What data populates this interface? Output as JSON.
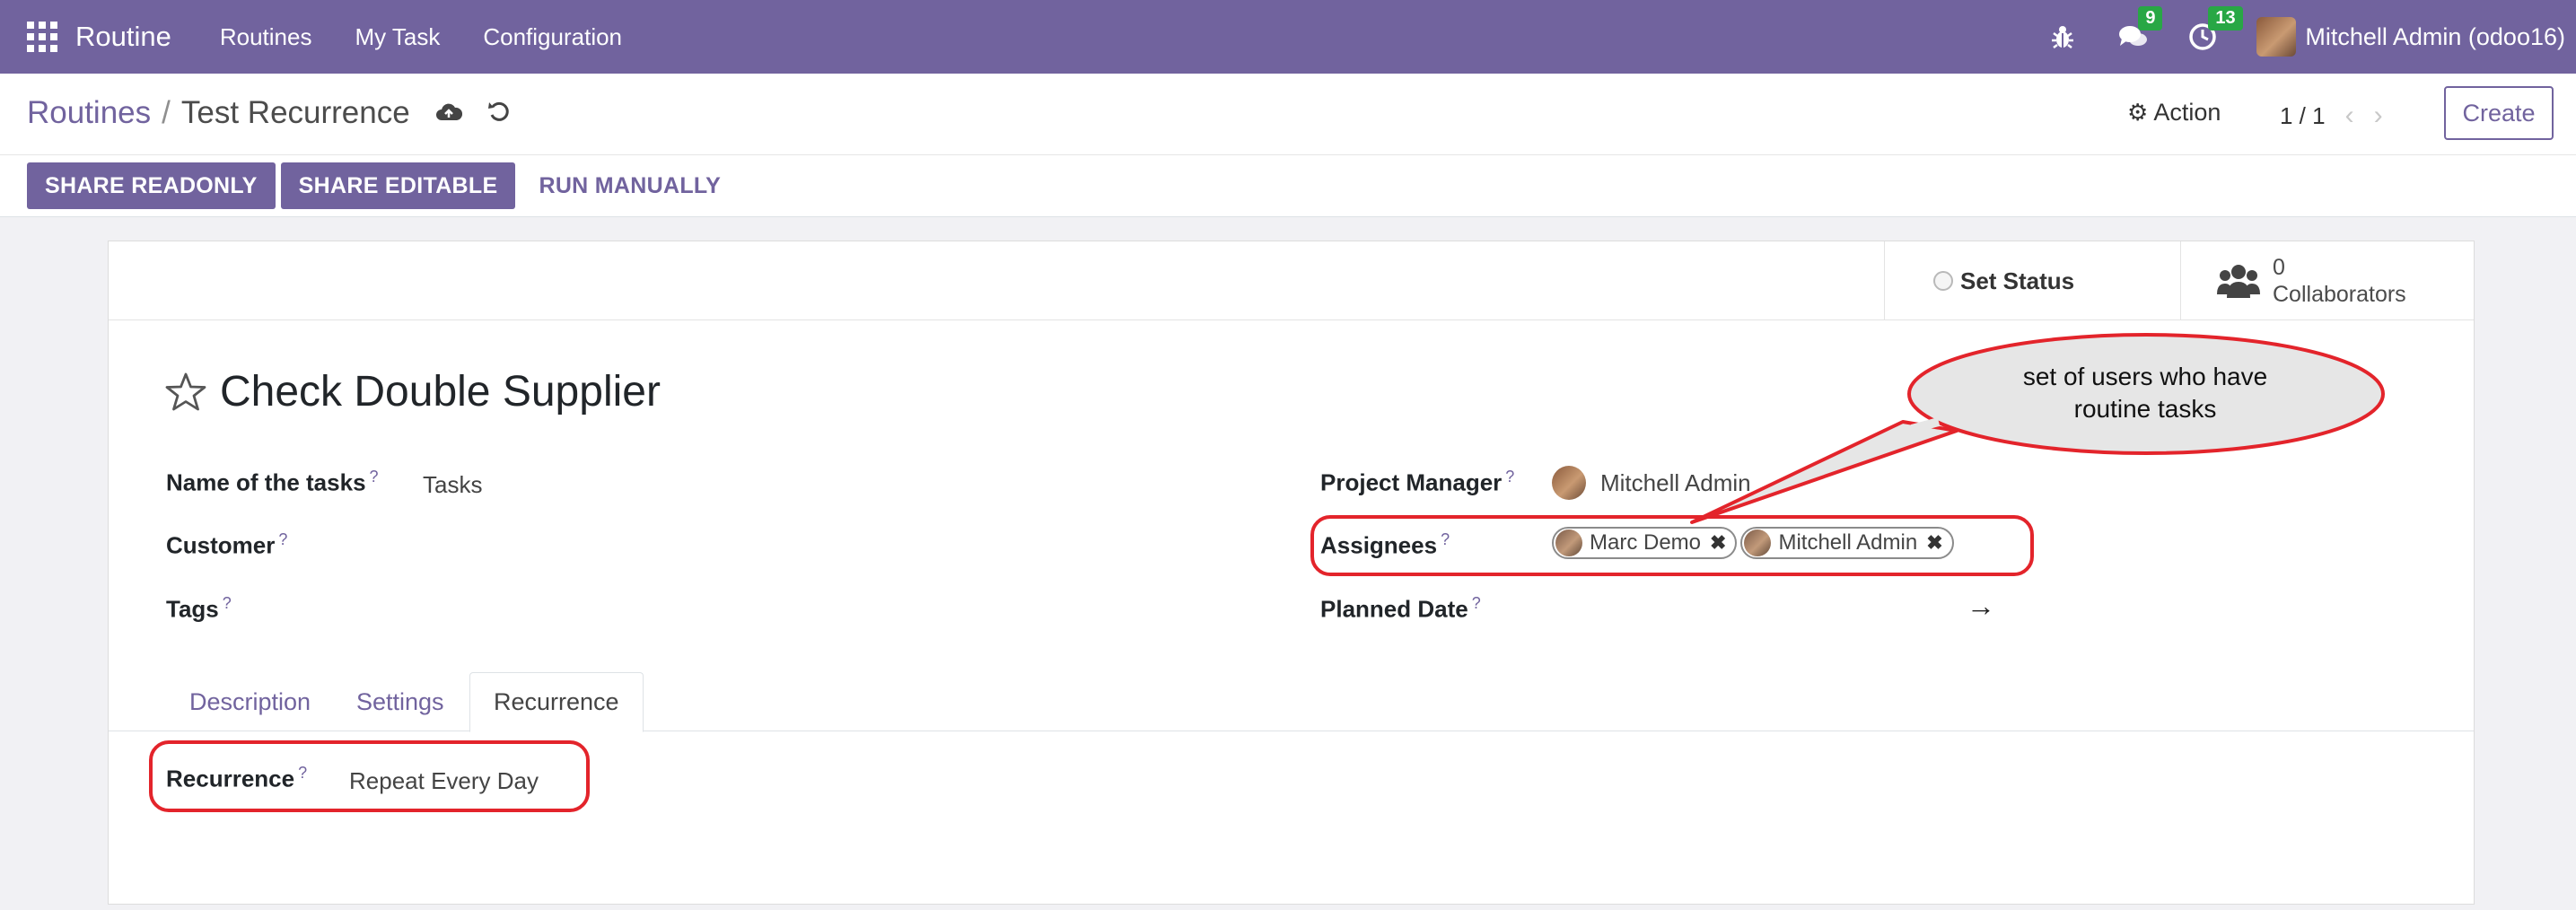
{
  "navbar": {
    "app_name": "Routine",
    "menu": [
      "Routines",
      "My Task",
      "Configuration"
    ],
    "messages_count": "9",
    "activities_count": "13",
    "user": "Mitchell Admin (odoo16)"
  },
  "breadcrumb": {
    "parent": "Routines",
    "separator": "/",
    "current": "Test Recurrence"
  },
  "control": {
    "action_label": "Action",
    "pager": "1 / 1",
    "create_label": "Create"
  },
  "buttons": {
    "share_readonly": "SHARE READONLY",
    "share_editable": "SHARE EDITABLE",
    "run_manually": "RUN MANUALLY"
  },
  "form": {
    "set_status": "Set Status",
    "collaborators_count": "0",
    "collaborators_label": "Collaborators",
    "title": "Check Double Supplier",
    "fields_left": {
      "name_of_tasks_label": "Name of the tasks",
      "name_of_tasks_value": "Tasks",
      "customer_label": "Customer",
      "tags_label": "Tags"
    },
    "fields_right": {
      "project_manager_label": "Project Manager",
      "project_manager_value": "Mitchell Admin",
      "assignees_label": "Assignees",
      "assignees": [
        "Marc Demo",
        "Mitchell Admin"
      ],
      "planned_date_label": "Planned Date",
      "planned_date_arrow": "→"
    },
    "help_marker": "?",
    "tabs": [
      "Description",
      "Settings",
      "Recurrence"
    ],
    "active_tab": "Recurrence",
    "recurrence_label": "Recurrence",
    "recurrence_value": "Repeat Every Day"
  },
  "annotation": {
    "callout_line1": "set of users who have",
    "callout_line2": "routine tasks"
  },
  "colors": {
    "brand": "#71639e",
    "badge": "#28a745",
    "highlight": "#e3242b"
  }
}
